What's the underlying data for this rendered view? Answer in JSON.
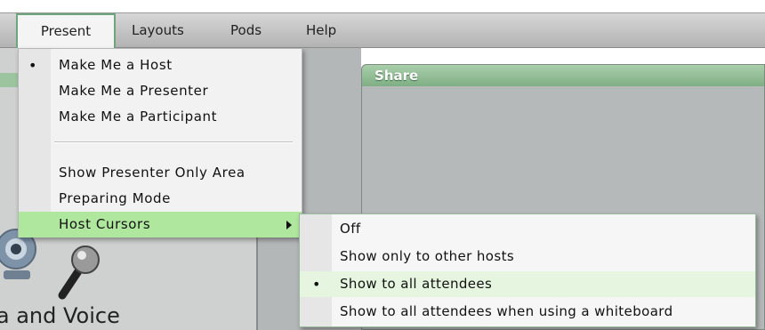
{
  "menubar": {
    "items": [
      "Present",
      "Layouts",
      "Pods",
      "Help"
    ]
  },
  "share_pod": {
    "title": "Share"
  },
  "camera_pod": {
    "label_partial": "ra and Voice"
  },
  "present_menu": {
    "items": [
      {
        "label": "Make Me a Host",
        "checked": true
      },
      {
        "label": "Make Me a Presenter",
        "checked": false
      },
      {
        "label": "Make Me a Participant",
        "checked": false
      },
      {
        "label": "Show Presenter Only Area",
        "checked": false
      },
      {
        "label": "Preparing Mode",
        "checked": false
      },
      {
        "label": "Host Cursors",
        "highlighted": true,
        "has_submenu": true
      }
    ],
    "bullet": "•"
  },
  "host_cursors_submenu": {
    "items": [
      {
        "label": "Off",
        "checked": false
      },
      {
        "label": "Show only to other hosts",
        "checked": false
      },
      {
        "label": "Show to all attendees",
        "checked": true
      },
      {
        "label": "Show to all attendees when using a whiteboard",
        "checked": false
      }
    ],
    "bullet": "•"
  },
  "colors": {
    "accent_green": "#aee79d",
    "header_green": "#7fae84",
    "menubar_gray": "#c4c4c4"
  },
  "icons": {
    "camera": "webcam-icon",
    "microphone": "microphone-icon",
    "submenu_arrow": "triangle-right-icon"
  }
}
